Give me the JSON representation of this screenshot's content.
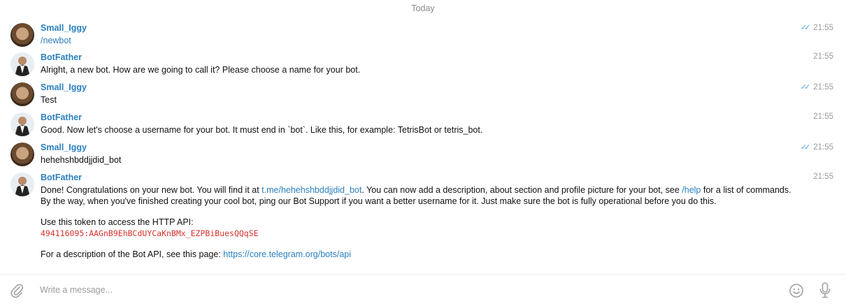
{
  "date_separator": "Today",
  "messages": [
    {
      "sender": "Small_Iggy",
      "text": "/newbot",
      "time": "21:55",
      "read": true
    },
    {
      "sender": "BotFather",
      "text": "Alright, a new bot. How are we going to call it? Please choose a name for your bot.",
      "time": "21:55"
    },
    {
      "sender": "Small_Iggy",
      "text": "Test",
      "time": "21:55",
      "read": true
    },
    {
      "sender": "BotFather",
      "text": "Good. Now let's choose a username for your bot. It must end in `bot`. Like this, for example: TetrisBot or tetris_bot.",
      "time": "21:55"
    },
    {
      "sender": "Small_Iggy",
      "text": "hehehshbddjjdid_bot",
      "time": "21:55",
      "read": true
    },
    {
      "sender": "BotFather",
      "time": "21:55",
      "part1": "Done! Congratulations on your new bot. You will find it at ",
      "link1": "t.me/hehehshbddjjdid_bot",
      "part2": ". You can now add a description, about section and profile picture for your bot, see ",
      "link2": "/help",
      "part3": " for a list of commands. By the way, when you've finished creating your cool bot, ping our Bot Support if you want a better username for it. Just make sure the bot is fully operational before you do this.",
      "token_intro": "Use this token to access the HTTP API:",
      "token": "494116095:AAGnB9EhBCdUYCaKnBMx_EZPBiBuesQQqSE",
      "api_intro": "For a description of the Bot API, see this page: ",
      "api_link": "https://core.telegram.org/bots/api"
    }
  ],
  "composer": {
    "placeholder": "Write a message..."
  },
  "colors": {
    "accent": "#2b7fc0",
    "token": "#d8322c",
    "check": "#5aa3e0"
  },
  "icons": [
    "paperclip-icon",
    "emoji-icon",
    "microphone-icon",
    "double-check-icon"
  ]
}
